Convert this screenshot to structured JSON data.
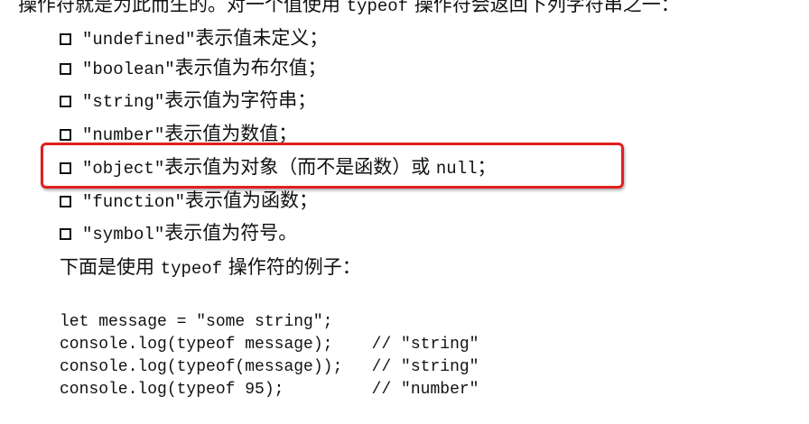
{
  "intro": {
    "a": "操作符就是为此而生的。对一个值使用 ",
    "b": "typeof",
    "c": " 操作符会返回下列字符串之一："
  },
  "items": [
    {
      "code": "\"undefined\"",
      "text": "表示值未定义；"
    },
    {
      "code": "\"boolean\"",
      "text": "表示值为布尔值；"
    },
    {
      "code": "\"string\"",
      "text": "表示值为字符串；"
    },
    {
      "code": "\"number\"",
      "text": "表示值为数值；"
    },
    {
      "code": "\"object\"",
      "text": "表示值为对象（而不是函数）或 ",
      "code2": "null",
      "tail": "；"
    },
    {
      "code": "\"function\"",
      "text": "表示值为函数；"
    },
    {
      "code": "\"symbol\"",
      "text": "表示值为符号。"
    }
  ],
  "example": {
    "a": "下面是使用 ",
    "b": "typeof",
    "c": " 操作符的例子："
  },
  "code": [
    "let message = \"some string\";",
    "console.log(typeof message);    // \"string\"",
    "console.log(typeof(message));   // \"string\"",
    "console.log(typeof 95);         // \"number\""
  ],
  "highlight_color": "#e0201e"
}
